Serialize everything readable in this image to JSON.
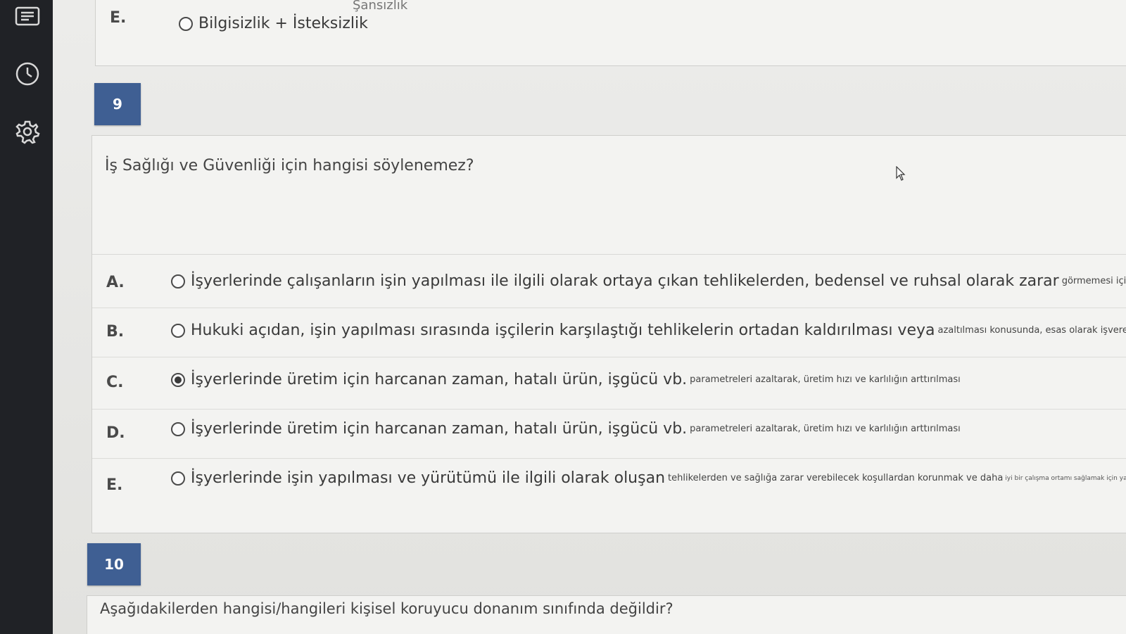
{
  "sidebar": {
    "icons": [
      "list-icon",
      "clock-icon",
      "gear-icon"
    ]
  },
  "top_fragment": {
    "text": "Şansızlık",
    "letter": "E.",
    "option": "Bilgisizlik + İsteksizlik"
  },
  "question9": {
    "number": "9",
    "text": "İş Sağlığı ve Güvenliği için hangisi söylenemez?",
    "options": [
      {
        "letter": "A.",
        "main": "İşyerlerinde çalışanların işin yapılması ile ilgili olarak ortaya çıkan tehlikelerden, bedensel ve ruhsal olarak zarar",
        "small": "görmemesi için alınması gerekli hukuki, teknik ve tıbbi önemleri sağla",
        "tiny": "",
        "selected": false
      },
      {
        "letter": "B.",
        "main": "Hukuki açıdan, işin yapılması sırasında işçilerin karşılaştığı tehlikelerin ortadan kaldırılması veya",
        "small": "azaltılması konusunda, esas olarak işverene, kamu hukuku temelinde getirilen yüküm",
        "tiny": "",
        "selected": false
      },
      {
        "letter": "C.",
        "main": "İşyerlerinde üretim için harcanan zaman, hatalı ürün, işgücü vb.",
        "small": "parametreleri azaltarak, üretim hızı ve karlılığın arttırılması",
        "tiny": "",
        "selected": true
      },
      {
        "letter": "D.",
        "main": "İşyerlerinde üretim için harcanan zaman, hatalı ürün, işgücü vb.",
        "small": "parametreleri azaltarak, üretim hızı ve karlılığın arttırılması",
        "tiny": "",
        "selected": false
      },
      {
        "letter": "E.",
        "main": "İşyerlerinde işin yapılması ve yürütümü ile ilgili olarak oluşan",
        "small": "tehlikelerden ve sağlığa zarar verebilecek koşullardan korunmak ve daha",
        "tiny": "iyi bir çalışma ortamı sağlamak için yapılan sistem",
        "selected": false
      }
    ]
  },
  "question10": {
    "number": "10",
    "text": "Aşağıdakilerden hangisi/hangileri kişisel koruyucu donanım sınıfında değildir?"
  }
}
